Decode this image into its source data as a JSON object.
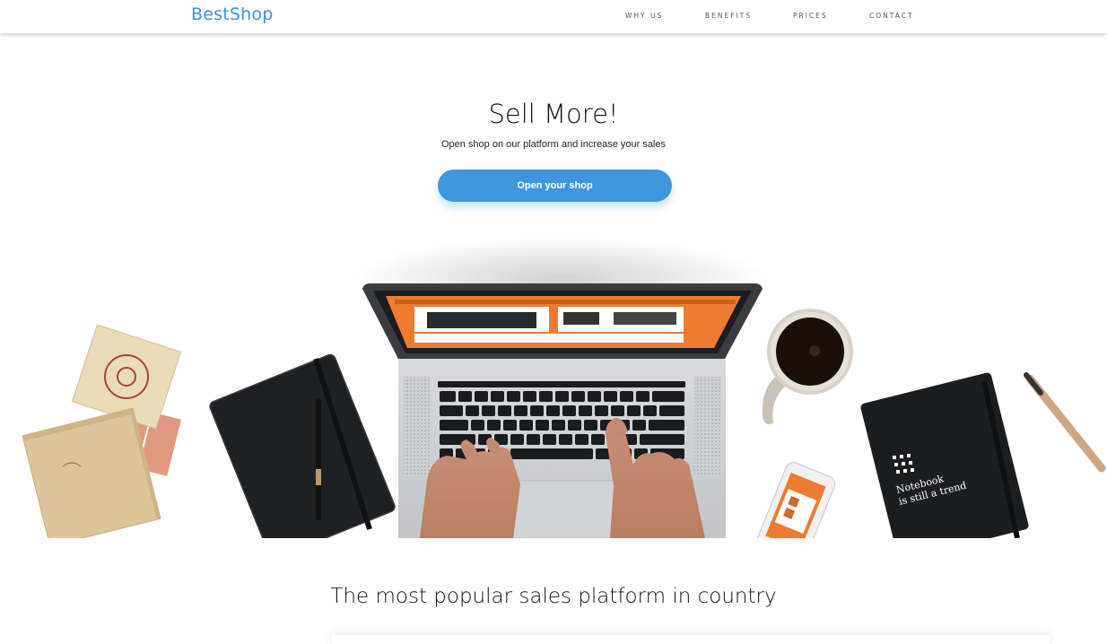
{
  "header": {
    "logo": "BestShop",
    "nav": [
      {
        "label": "WHY US"
      },
      {
        "label": "BENEFITS"
      },
      {
        "label": "PRICES"
      },
      {
        "label": "CONTACT"
      }
    ]
  },
  "hero": {
    "title": "Sell More!",
    "subtitle": "Open shop on our platform and increase your sales",
    "cta_label": "Open your shop"
  },
  "illustration": {
    "notebook_text_line1": "Notebook",
    "notebook_text_line2": "is still a trend"
  },
  "section": {
    "title": "The most popular sales platform in country"
  },
  "colors": {
    "brand_blue": "#3a93d8",
    "button_blue": "#3f96dc",
    "screen_orange": "#ee7b2f"
  }
}
